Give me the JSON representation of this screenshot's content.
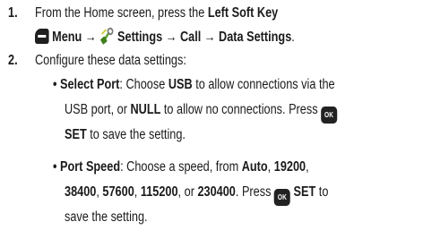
{
  "step1": {
    "number": "1.",
    "line1_a": "From the Home screen, press the ",
    "line1_b": "Left Soft Key",
    "menu_label": "Menu",
    "arrow": "→",
    "settings_label": "Settings",
    "call_label": "Call",
    "data_settings_label": "Data Settings",
    "period": ".",
    "icons": {
      "softkey": "left-soft-key-icon",
      "settings": "settings-icon"
    }
  },
  "step2": {
    "number": "2.",
    "intro": "Configure these data settings:",
    "bullet": "•",
    "select_port": {
      "title": "Select Port",
      "t1": ": Choose ",
      "usb": "USB",
      "t2": " to allow connections via the",
      "t3": "USB port, or ",
      "null": "NULL",
      "t4": " to allow no connections. Press ",
      "ok_label": "OK",
      "set": "SET",
      "t5": " to save the setting."
    },
    "port_speed": {
      "title": "Port Speed",
      "t1": ": Choose a speed, from ",
      "auto": "Auto",
      "comma": ", ",
      "s19200": "19200",
      "s38400": "38400",
      "s57600": "57600",
      "s115200": "115200",
      "or": ", or ",
      "s230400": "230400",
      "press": ". Press ",
      "ok_label": "OK",
      "set": "SET",
      "to": " to",
      "t_end": "save the setting."
    }
  }
}
